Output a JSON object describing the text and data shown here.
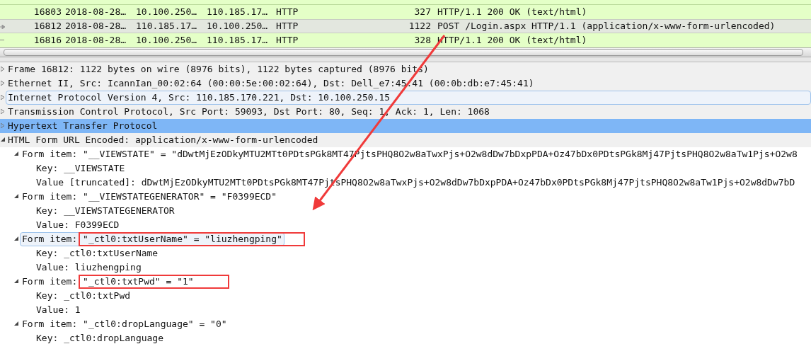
{
  "packets": [
    {
      "no": "16803",
      "time": "2018-08-28…",
      "source": "10.100.250…",
      "destination": "110.185.17…",
      "protocol": "HTTP",
      "length": "327",
      "info": "HTTP/1.1 200 OK  (text/html)",
      "selected": false,
      "related": false
    },
    {
      "no": "16812",
      "time": "2018-08-28…",
      "source": "110.185.17…",
      "destination": "10.100.250…",
      "protocol": "HTTP",
      "length": "1122",
      "info": "POST /Login.aspx HTTP/1.1  (application/x-www-form-urlencoded)",
      "selected": true,
      "related": false
    },
    {
      "no": "16816",
      "time": "2018-08-28…",
      "source": "10.100.250…",
      "destination": "110.185.17…",
      "protocol": "HTTP",
      "length": "328",
      "info": "HTTP/1.1 200 OK  (text/html)",
      "selected": false,
      "related": true
    }
  ],
  "details": [
    {
      "text": "Frame 16812: 1122 bytes on wire (8976 bits), 1122 bytes captured (8976 bits)",
      "expanded": false,
      "selected": false,
      "highlighted": false
    },
    {
      "text": "Ethernet II, Src: IcannIan_00:02:64 (00:00:5e:00:02:64), Dst: Dell_e7:45:41 (00:0b:db:e7:45:41)",
      "expanded": false,
      "selected": false,
      "highlighted": false
    },
    {
      "text": "Internet Protocol Version 4, Src: 110.185.170.221, Dst: 10.100.250.15",
      "expanded": false,
      "selected": false,
      "highlighted": true
    },
    {
      "text": "Transmission Control Protocol, Src Port: 59093, Dst Port: 80, Seq: 1, Ack: 1, Len: 1068",
      "expanded": false,
      "selected": false,
      "highlighted": false
    },
    {
      "text": "Hypertext Transfer Protocol",
      "expanded": false,
      "selected": true,
      "highlighted": false
    },
    {
      "text": "HTML Form URL Encoded: application/x-www-form-urlencoded",
      "expanded": true,
      "selected": false,
      "highlighted": false,
      "children": [
        {
          "text": "Form item: \"__VIEWSTATE\" = \"dDwtMjEzODkyMTU2MTt0PDtsPGk8MT47PjtsPHQ8O2w8aTwxPjs+O2w8dDw7bDxpPDA+Oz47bDx0PDtsPGk8Mj47PjtsPHQ8O2w8aTw1Pjs+O2w8",
          "expanded": true,
          "selected": false,
          "highlighted": false,
          "children": [
            {
              "text": "Key: __VIEWSTATE",
              "selected": false,
              "highlighted": false
            },
            {
              "text": "Value [truncated]: dDwtMjEzODkyMTU2MTt0PDtsPGk8MT47PjtsPHQ8O2w8aTwxPjs+O2w8dDw7bDxpPDA+Oz47bDx0PDtsPGk8Mj47PjtsPHQ8O2w8aTw1Pjs+O2w8dDw7bD",
              "selected": false,
              "highlighted": false
            }
          ]
        },
        {
          "text": "Form item: \"__VIEWSTATEGENERATOR\" = \"F0399ECD\"",
          "expanded": true,
          "selected": false,
          "highlighted": false,
          "children": [
            {
              "text": "Key: __VIEWSTATEGENERATOR",
              "selected": false,
              "highlighted": false
            },
            {
              "text": "Value: F0399ECD",
              "selected": false,
              "highlighted": false
            }
          ]
        },
        {
          "text": "Form item: \"_ctl0:txtUserName\" = \"liuzhengping\"",
          "expanded": true,
          "selected": false,
          "highlighted": true,
          "children": [
            {
              "text": "Key: _ctl0:txtUserName",
              "selected": false,
              "highlighted": false
            },
            {
              "text": "Value: liuzhengping",
              "selected": false,
              "highlighted": false
            }
          ]
        },
        {
          "text": "Form item: \"_ctl0:txtPwd\" = \"1\"",
          "expanded": true,
          "selected": false,
          "highlighted": false,
          "children": [
            {
              "text": "Key: _ctl0:txtPwd",
              "selected": false,
              "highlighted": false
            },
            {
              "text": "Value: 1",
              "selected": false,
              "highlighted": false
            }
          ]
        },
        {
          "text": "Form item: \"_ctl0:dropLanguage\" = \"0\"",
          "expanded": true,
          "selected": false,
          "highlighted": false,
          "children": [
            {
              "text": "Key: _ctl0:dropLanguage",
              "selected": false,
              "highlighted": false
            }
          ]
        }
      ]
    }
  ],
  "annotations": [
    {
      "kind": "box"
    },
    {
      "kind": "box"
    },
    {
      "kind": "arrow"
    }
  ]
}
